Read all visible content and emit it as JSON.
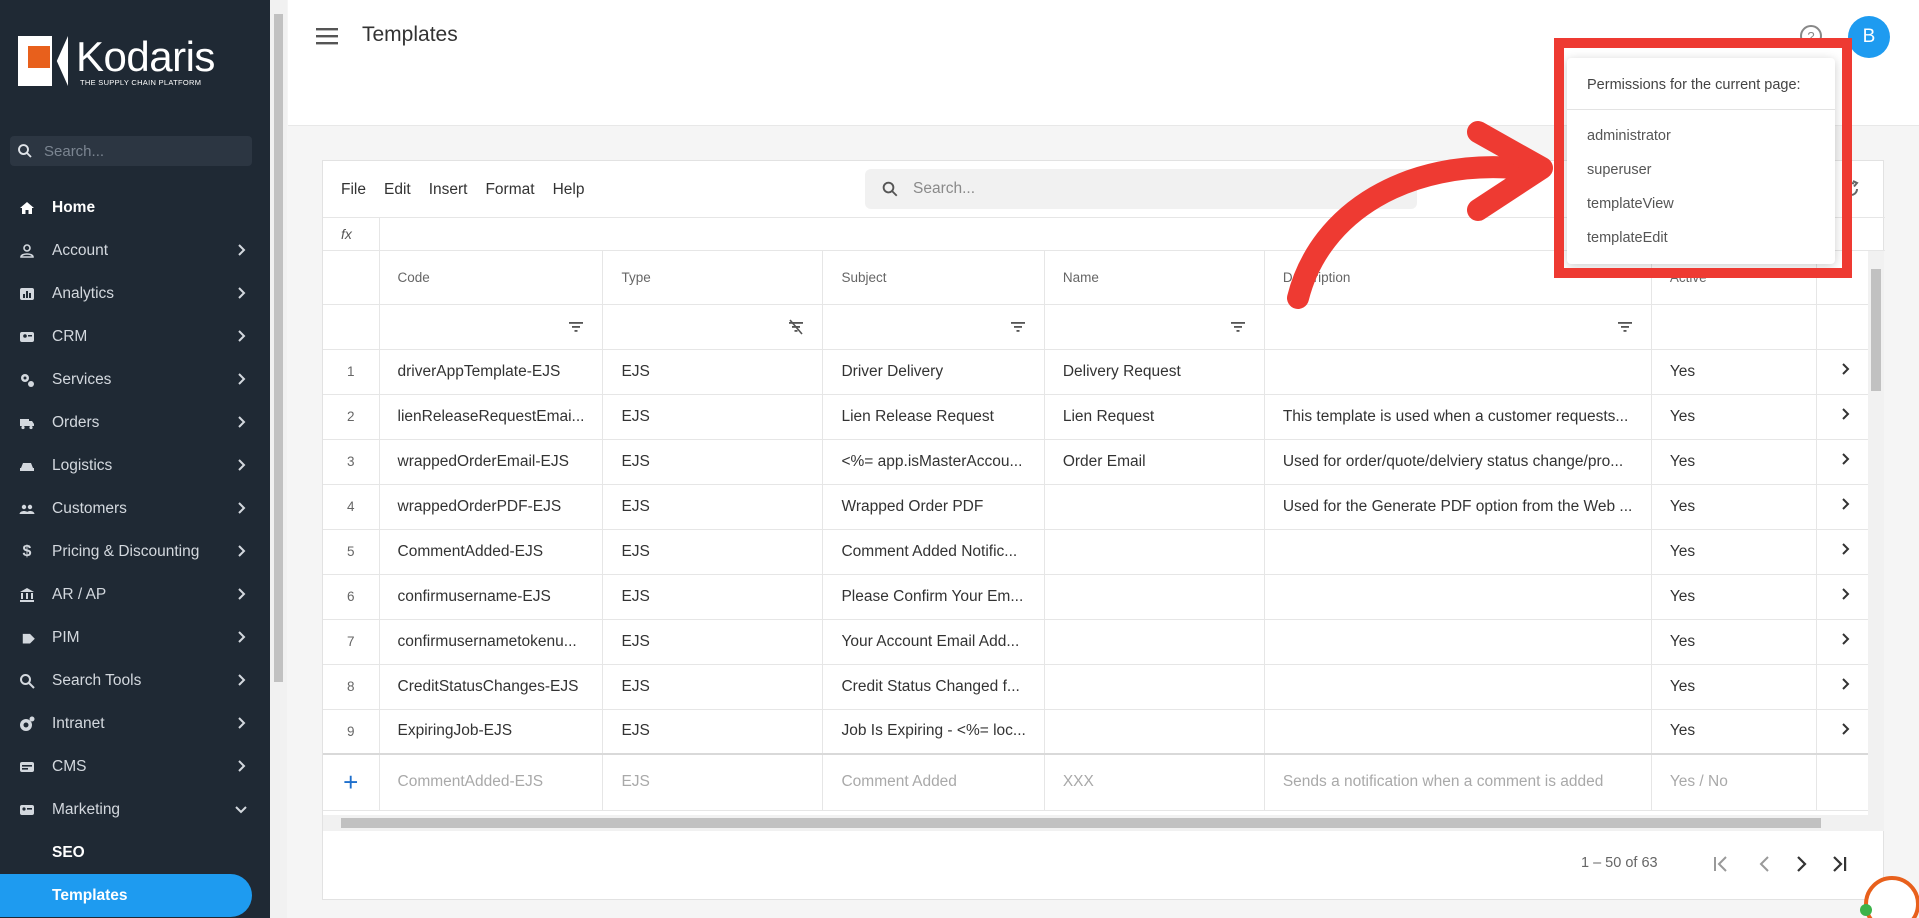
{
  "brand": {
    "name": "Kodaris",
    "tagline": "THE SUPPLY CHAIN PLATFORM",
    "accent": "#1e9bf0",
    "logo_orange": "#e8601c"
  },
  "sidebar": {
    "search_placeholder": "Search...",
    "items": [
      {
        "label": "Home",
        "icon": "home-icon"
      },
      {
        "label": "Account",
        "icon": "person-icon"
      },
      {
        "label": "Analytics",
        "icon": "analytics-icon"
      },
      {
        "label": "CRM",
        "icon": "crm-icon"
      },
      {
        "label": "Services",
        "icon": "gears-icon"
      },
      {
        "label": "Orders",
        "icon": "truck-icon"
      },
      {
        "label": "Logistics",
        "icon": "logistics-icon"
      },
      {
        "label": "Customers",
        "icon": "people-icon"
      },
      {
        "label": "Pricing & Discounting",
        "icon": "dollar-icon"
      },
      {
        "label": "AR / AP",
        "icon": "bank-icon"
      },
      {
        "label": "PIM",
        "icon": "tag-icon"
      },
      {
        "label": "Search Tools",
        "icon": "search-icon"
      },
      {
        "label": "Intranet",
        "icon": "intranet-icon"
      },
      {
        "label": "CMS",
        "icon": "cms-icon"
      },
      {
        "label": "Marketing",
        "icon": "marketing-icon"
      }
    ],
    "sub_items": [
      {
        "label": "SEO"
      },
      {
        "label": "Templates"
      }
    ]
  },
  "header": {
    "title": "Templates",
    "avatar_letter": "B"
  },
  "grid": {
    "menu": [
      "File",
      "Edit",
      "Insert",
      "Format",
      "Help"
    ],
    "search_placeholder": "Search...",
    "fx_label": "fx",
    "columns": [
      "Code",
      "Type",
      "Subject",
      "Name",
      "Description",
      "Active"
    ],
    "rows": [
      {
        "num": "1",
        "code": "driverAppTemplate-EJS",
        "type": "EJS",
        "subject": "Driver Delivery",
        "name": "Delivery Request",
        "desc": "",
        "active": "Yes"
      },
      {
        "num": "2",
        "code": "lienReleaseRequestEmai...",
        "type": "EJS",
        "subject": "Lien Release Request",
        "name": "Lien Request",
        "desc": "This template is used when a customer requests...",
        "active": "Yes"
      },
      {
        "num": "3",
        "code": "wrappedOrderEmail-EJS",
        "type": "EJS",
        "subject": "<%= app.isMasterAccou...",
        "name": "Order Email",
        "desc": "Used for order/quote/delviery status change/pro...",
        "active": "Yes"
      },
      {
        "num": "4",
        "code": "wrappedOrderPDF-EJS",
        "type": "EJS",
        "subject": "Wrapped Order PDF",
        "name": "",
        "desc": "Used for the Generate PDF option from the Web ...",
        "active": "Yes"
      },
      {
        "num": "5",
        "code": "CommentAdded-EJS",
        "type": "EJS",
        "subject": "Comment Added Notific...",
        "name": "",
        "desc": "",
        "active": "Yes"
      },
      {
        "num": "6",
        "code": "confirmusername-EJS",
        "type": "EJS",
        "subject": "Please Confirm Your Em...",
        "name": "",
        "desc": "",
        "active": "Yes"
      },
      {
        "num": "7",
        "code": "confirmusernametokenu...",
        "type": "EJS",
        "subject": "Your Account Email Add...",
        "name": "",
        "desc": "",
        "active": "Yes"
      },
      {
        "num": "8",
        "code": "CreditStatusChanges-EJS",
        "type": "EJS",
        "subject": "Credit Status Changed f...",
        "name": "",
        "desc": "",
        "active": "Yes"
      },
      {
        "num": "9",
        "code": "ExpiringJob-EJS",
        "type": "EJS",
        "subject": "Job Is Expiring - <%= loc...",
        "name": "",
        "desc": "",
        "active": "Yes"
      }
    ],
    "new_row": {
      "code": "CommentAdded-EJS",
      "type": "EJS",
      "subject": "Comment Added",
      "name": "XXX",
      "desc": "Sends a notification when a comment is added",
      "active": "Yes / No"
    },
    "paginator": "1 – 50 of 63"
  },
  "permissions": {
    "title": "Permissions for the current page:",
    "items": [
      "administrator",
      "superuser",
      "templateView",
      "templateEdit"
    ],
    "highlight_color": "#ee3a32"
  }
}
